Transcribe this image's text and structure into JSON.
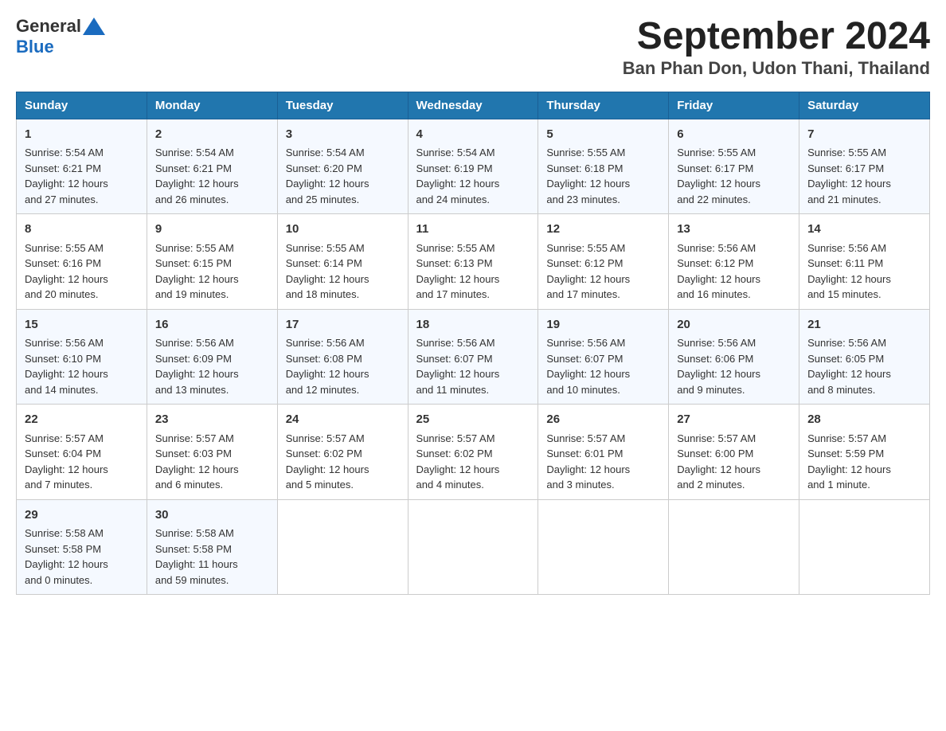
{
  "header": {
    "logo_text_main": "General",
    "logo_text_blue": "Blue",
    "title": "September 2024",
    "subtitle": "Ban Phan Don, Udon Thani, Thailand"
  },
  "calendar": {
    "days_of_week": [
      "Sunday",
      "Monday",
      "Tuesday",
      "Wednesday",
      "Thursday",
      "Friday",
      "Saturday"
    ],
    "weeks": [
      [
        {
          "day": "1",
          "sunrise": "5:54 AM",
          "sunset": "6:21 PM",
          "daylight_hours": "12",
          "daylight_minutes": "27"
        },
        {
          "day": "2",
          "sunrise": "5:54 AM",
          "sunset": "6:21 PM",
          "daylight_hours": "12",
          "daylight_minutes": "26"
        },
        {
          "day": "3",
          "sunrise": "5:54 AM",
          "sunset": "6:20 PM",
          "daylight_hours": "12",
          "daylight_minutes": "25"
        },
        {
          "day": "4",
          "sunrise": "5:54 AM",
          "sunset": "6:19 PM",
          "daylight_hours": "12",
          "daylight_minutes": "24"
        },
        {
          "day": "5",
          "sunrise": "5:55 AM",
          "sunset": "6:18 PM",
          "daylight_hours": "12",
          "daylight_minutes": "23"
        },
        {
          "day": "6",
          "sunrise": "5:55 AM",
          "sunset": "6:17 PM",
          "daylight_hours": "12",
          "daylight_minutes": "22"
        },
        {
          "day": "7",
          "sunrise": "5:55 AM",
          "sunset": "6:17 PM",
          "daylight_hours": "12",
          "daylight_minutes": "21"
        }
      ],
      [
        {
          "day": "8",
          "sunrise": "5:55 AM",
          "sunset": "6:16 PM",
          "daylight_hours": "12",
          "daylight_minutes": "20"
        },
        {
          "day": "9",
          "sunrise": "5:55 AM",
          "sunset": "6:15 PM",
          "daylight_hours": "12",
          "daylight_minutes": "19"
        },
        {
          "day": "10",
          "sunrise": "5:55 AM",
          "sunset": "6:14 PM",
          "daylight_hours": "12",
          "daylight_minutes": "18"
        },
        {
          "day": "11",
          "sunrise": "5:55 AM",
          "sunset": "6:13 PM",
          "daylight_hours": "12",
          "daylight_minutes": "17"
        },
        {
          "day": "12",
          "sunrise": "5:55 AM",
          "sunset": "6:12 PM",
          "daylight_hours": "12",
          "daylight_minutes": "17"
        },
        {
          "day": "13",
          "sunrise": "5:56 AM",
          "sunset": "6:12 PM",
          "daylight_hours": "12",
          "daylight_minutes": "16"
        },
        {
          "day": "14",
          "sunrise": "5:56 AM",
          "sunset": "6:11 PM",
          "daylight_hours": "12",
          "daylight_minutes": "15"
        }
      ],
      [
        {
          "day": "15",
          "sunrise": "5:56 AM",
          "sunset": "6:10 PM",
          "daylight_hours": "12",
          "daylight_minutes": "14"
        },
        {
          "day": "16",
          "sunrise": "5:56 AM",
          "sunset": "6:09 PM",
          "daylight_hours": "12",
          "daylight_minutes": "13"
        },
        {
          "day": "17",
          "sunrise": "5:56 AM",
          "sunset": "6:08 PM",
          "daylight_hours": "12",
          "daylight_minutes": "12"
        },
        {
          "day": "18",
          "sunrise": "5:56 AM",
          "sunset": "6:07 PM",
          "daylight_hours": "12",
          "daylight_minutes": "11"
        },
        {
          "day": "19",
          "sunrise": "5:56 AM",
          "sunset": "6:07 PM",
          "daylight_hours": "12",
          "daylight_minutes": "10"
        },
        {
          "day": "20",
          "sunrise": "5:56 AM",
          "sunset": "6:06 PM",
          "daylight_hours": "12",
          "daylight_minutes": "9"
        },
        {
          "day": "21",
          "sunrise": "5:56 AM",
          "sunset": "6:05 PM",
          "daylight_hours": "12",
          "daylight_minutes": "8"
        }
      ],
      [
        {
          "day": "22",
          "sunrise": "5:57 AM",
          "sunset": "6:04 PM",
          "daylight_hours": "12",
          "daylight_minutes": "7"
        },
        {
          "day": "23",
          "sunrise": "5:57 AM",
          "sunset": "6:03 PM",
          "daylight_hours": "12",
          "daylight_minutes": "6"
        },
        {
          "day": "24",
          "sunrise": "5:57 AM",
          "sunset": "6:02 PM",
          "daylight_hours": "12",
          "daylight_minutes": "5"
        },
        {
          "day": "25",
          "sunrise": "5:57 AM",
          "sunset": "6:02 PM",
          "daylight_hours": "12",
          "daylight_minutes": "4"
        },
        {
          "day": "26",
          "sunrise": "5:57 AM",
          "sunset": "6:01 PM",
          "daylight_hours": "12",
          "daylight_minutes": "3"
        },
        {
          "day": "27",
          "sunrise": "5:57 AM",
          "sunset": "6:00 PM",
          "daylight_hours": "12",
          "daylight_minutes": "2"
        },
        {
          "day": "28",
          "sunrise": "5:57 AM",
          "sunset": "5:59 PM",
          "daylight_hours": "12",
          "daylight_minutes": "1"
        }
      ],
      [
        {
          "day": "29",
          "sunrise": "5:58 AM",
          "sunset": "5:58 PM",
          "daylight_hours": "12",
          "daylight_minutes": "0"
        },
        {
          "day": "30",
          "sunrise": "5:58 AM",
          "sunset": "5:58 PM",
          "daylight_hours": "11",
          "daylight_minutes": "59"
        },
        null,
        null,
        null,
        null,
        null
      ]
    ]
  },
  "labels": {
    "sunrise": "Sunrise:",
    "sunset": "Sunset:",
    "daylight": "Daylight: 12 hours",
    "and": "and",
    "minutes": "minutes."
  }
}
